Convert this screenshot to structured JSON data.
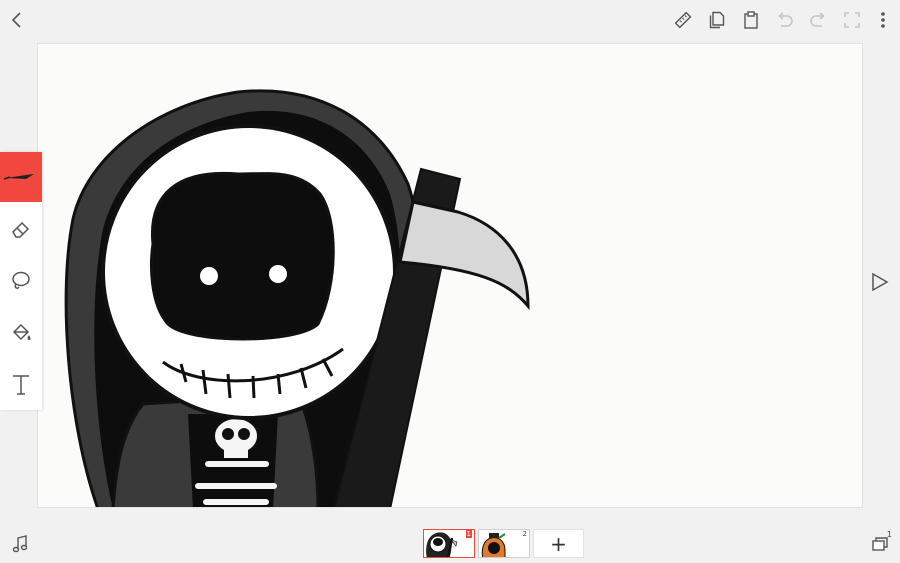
{
  "app": {
    "colors": {
      "accent": "#f0483e",
      "icon": "#555555",
      "disabled": "#c4c4c4",
      "canvas": "#fbfbf9"
    }
  },
  "topbar": {
    "back_icon": "chevron-left-icon",
    "ruler_icon": "ruler-icon",
    "copy_icon": "copy-icon",
    "paste_icon": "paste-icon",
    "undo_icon": "undo-icon",
    "redo_icon": "redo-icon",
    "fullscreen_icon": "fullscreen-icon",
    "more_icon": "more-vertical-icon"
  },
  "tools": [
    {
      "name": "pen",
      "icon": "pen-icon",
      "active": true
    },
    {
      "name": "eraser",
      "icon": "eraser-icon",
      "active": false
    },
    {
      "name": "lasso",
      "icon": "lasso-icon",
      "active": false
    },
    {
      "name": "fill",
      "icon": "paint-bucket-icon",
      "active": false
    },
    {
      "name": "text",
      "icon": "text-icon",
      "active": false
    }
  ],
  "play_icon": "play-icon",
  "bottombar": {
    "music_icon": "music-note-icon",
    "layers_icon": "layers-icon",
    "layers_count": "1",
    "frames": [
      {
        "number": "1",
        "selected": true
      },
      {
        "number": "2",
        "selected": false
      }
    ],
    "add_frame_label": "+"
  }
}
